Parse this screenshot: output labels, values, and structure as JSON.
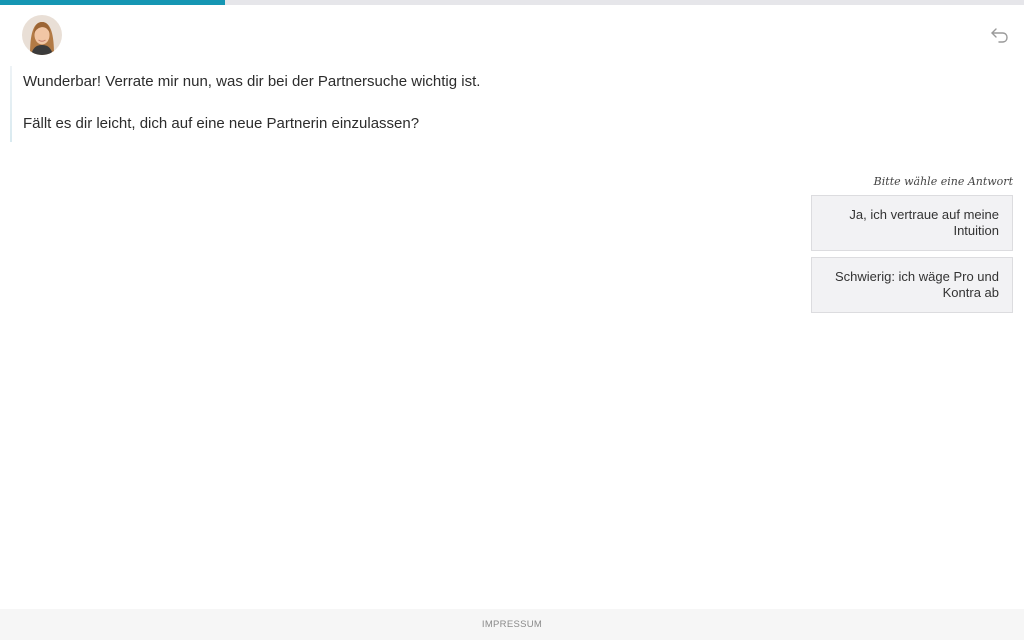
{
  "progress": {
    "fraction": 0.22,
    "color": "#1596b3"
  },
  "header": {
    "avatar_icon": "woman-portrait-avatar",
    "back_icon": "undo-arrow-icon"
  },
  "chat": {
    "message_1": "Wunderbar! Verrate mir nun, was dir bei der Partnersuche wichtig ist.",
    "message_2": "Fällt es dir leicht, dich auf eine neue Partnerin einzulassen?"
  },
  "answers": {
    "prompt": "Bitte wähle eine Antwort",
    "options": [
      {
        "label": "Ja, ich vertraue auf meine Intuition"
      },
      {
        "label": "Schwierig: ich wäge Pro und Kontra ab"
      }
    ]
  },
  "footer": {
    "impressum_label": "IMPRESSUM"
  }
}
